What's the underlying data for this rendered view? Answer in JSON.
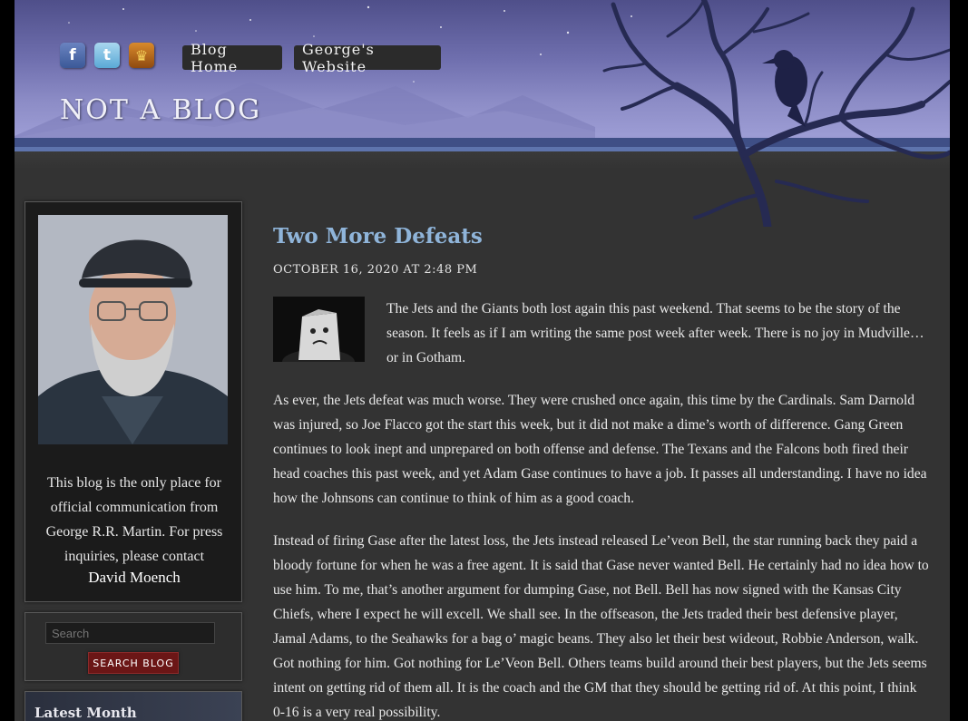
{
  "header": {
    "site_title": "NOT A BLOG",
    "nav": [
      {
        "label": "Blog Home"
      },
      {
        "label": "George's Website"
      }
    ],
    "social": [
      {
        "icon": "facebook-icon",
        "glyph": "f"
      },
      {
        "icon": "twitter-icon",
        "glyph": "t"
      },
      {
        "icon": "crown-icon",
        "glyph": "♛"
      }
    ]
  },
  "sidebar": {
    "bio": "This blog is the only place for official communication from George R.R. Martin. For press inquiries, please contact",
    "contact": "David Moench",
    "search": {
      "placeholder": "Search",
      "button": "SEARCH BLOG"
    },
    "latest_title": "Latest Month"
  },
  "post": {
    "title": "Two More Defeats",
    "date": "OCTOBER 16, 2020 AT 2:48 PM",
    "paragraphs": [
      "The Jets and the Giants both lost again this past weekend.   That seems to be the story of the season.  It feels as if I am writing the same post week after week.   There is no joy in Mudville… or in Gotham.",
      "As ever, the Jets defeat was much worse.   They were crushed once again, this time by the Cardinals.   Sam Darnold was injured, so Joe Flacco got the start this week, but it did not make a dime’s worth of difference.   Gang Green continues to look inept and unprepared on both offense and defense.  The Texans and the Falcons both fired their head coaches this past week, and yet Adam Gase continues to have a job.   It passes all understanding.   I have no idea how the Johnsons can continue to think of him as a good coach.",
      "Instead of firing Gase after the latest loss, the Jets instead released Le’veon Bell, the star running back they paid a bloody fortune for when he was a free agent.   It is said that Gase never wanted Bell.   He certainly had no idea how to use him.   To me, that’s another argument for dumping Gase, not Bell.  Bell has now signed with the Kansas City Chiefs, where I expect he will excell.   We shall see.   In the offseason, the Jets traded their best defensive player, Jamal Adams, to the Seahawks for a bag o’ magic beans.   They also let their best wideout, Robbie Anderson, walk.   Got nothing for him.   Got nothing for Le’Veon Bell.   Others teams build around their best players, but the Jets seems intent on getting rid of them all.   It is the coach and the GM that they should be getting rid of.   At this point, I think 0-16 is a very real possibility."
    ]
  },
  "colors": {
    "page_bg": "#333333",
    "title_blue": "#8fb4d9",
    "header_purple": "#8c8cc6",
    "search_button_red": "#6b1616"
  }
}
